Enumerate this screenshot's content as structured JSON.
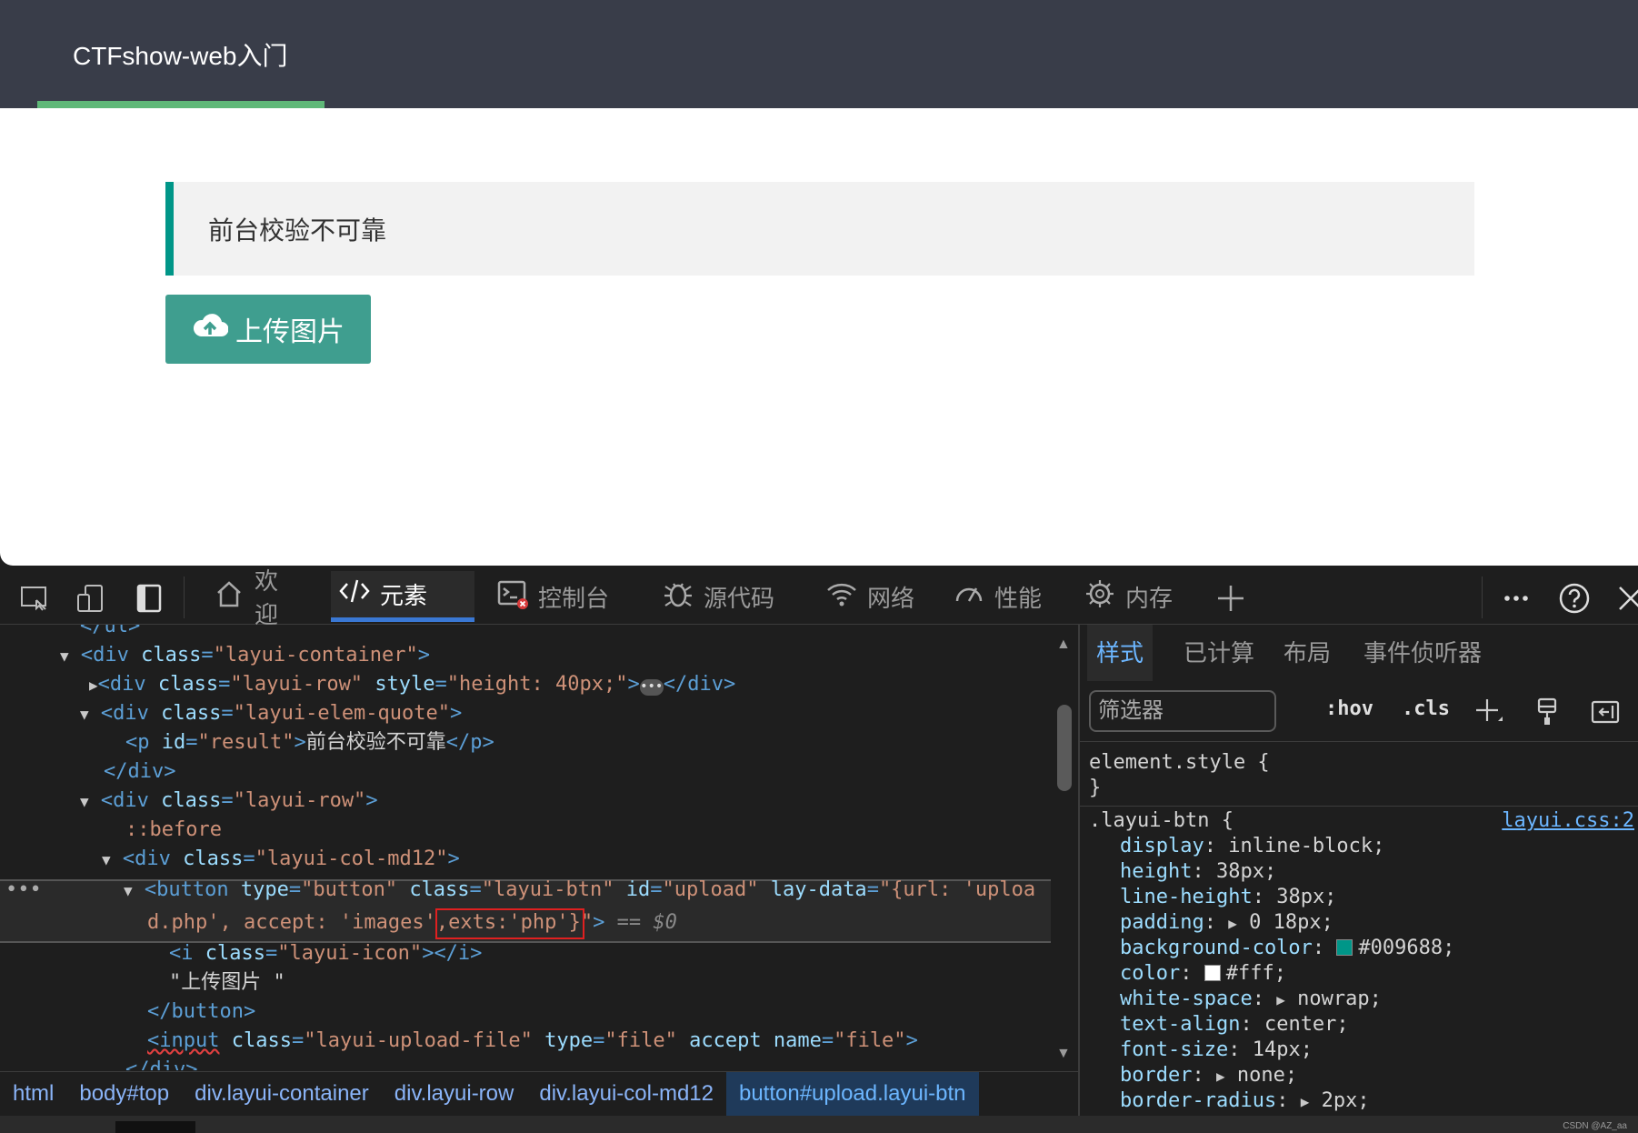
{
  "page": {
    "site_title": "CTFshow-web入门",
    "quote_text": "前台校验不可靠",
    "upload_button_label": "上传图片",
    "accent_color": "#009688"
  },
  "devtools": {
    "tabs": [
      {
        "label": "欢迎",
        "icon": "home-icon"
      },
      {
        "label": "元素",
        "icon": "code-icon",
        "active": true
      },
      {
        "label": "控制台",
        "icon": "console-icon"
      },
      {
        "label": "源代码",
        "icon": "bug-icon"
      },
      {
        "label": "网络",
        "icon": "wifi-icon"
      },
      {
        "label": "性能",
        "icon": "gauge-icon"
      },
      {
        "label": "内存",
        "icon": "chip-icon"
      }
    ],
    "dom": {
      "l0_tag": "</ul>",
      "l1_tag": "<div",
      "l1_attr": "class",
      "l1_val": "\"layui-container\"",
      "l2_tag": "<div",
      "l2_attr1": "class",
      "l2_val1": "\"layui-row\"",
      "l2_attr2": "style",
      "l2_val2": "\"height: 40px;\"",
      "l2_close": "</div>",
      "l3_tag": "<div",
      "l3_attr": "class",
      "l3_val": "\"layui-elem-quote\"",
      "l4_tag": "<p",
      "l4_attr": "id",
      "l4_val": "\"result\"",
      "l4_text": "前台校验不可靠",
      "l4_close": "</p>",
      "l5_tag": "</div>",
      "l6_tag": "<div",
      "l6_attr": "class",
      "l6_val": "\"layui-row\"",
      "l7_pseudo": "::before",
      "l8_tag": "<div",
      "l8_attr": "class",
      "l8_val": "\"layui-col-md12\"",
      "l9_tag": "<button",
      "l9_a1": "type",
      "l9_v1": "\"button\"",
      "l9_a2": "class",
      "l9_v2": "\"layui-btn\"",
      "l9_a3": "id",
      "l9_v3": "\"upload\"",
      "l9_a4": "lay-data",
      "l9_v4a": "\"{url: 'uploa",
      "l10_v4b": "d.php', accept: 'images'",
      "l10_v4c": ",exts:'php'}",
      "l10_v4d": "\"",
      "l10_eq": "== $0",
      "l11_tag": "<i",
      "l11_attr": "class",
      "l11_val": "\"layui-icon\"",
      "l11_text": "",
      "l11_close": "</i>",
      "l12_text": "\"上传图片 \"",
      "l13_tag": "</button>",
      "l14_tag": "<input",
      "l14_a1": "class",
      "l14_v1": "\"layui-upload-file\"",
      "l14_a2": "type",
      "l14_v2": "\"file\"",
      "l14_a3": "accept",
      "l14_a4": "name",
      "l14_v4": "\"file\"",
      "l15_tag": "</div>"
    },
    "breadcrumb": [
      "html",
      "body#top",
      "div.layui-container",
      "div.layui-row",
      "div.layui-col-md12",
      "button#upload.layui-btn"
    ],
    "styles": {
      "tabs": [
        "样式",
        "已计算",
        "布局",
        "事件侦听器"
      ],
      "filter_placeholder": "筛选器",
      "hov_label": ":hov",
      "cls_label": ".cls",
      "element_style_open": "element.style {",
      "element_style_close": "}",
      "rule_selector": ".layui-btn {",
      "rule_source": "layui.css:2",
      "declarations": [
        {
          "prop": "display",
          "val": "inline-block;"
        },
        {
          "prop": "height",
          "val": "38px;"
        },
        {
          "prop": "line-height",
          "val": "38px;"
        },
        {
          "prop": "padding",
          "val": "0 18px;",
          "expand": true
        },
        {
          "prop": "background-color",
          "val": "#009688;",
          "swatch": "#009688"
        },
        {
          "prop": "color",
          "val": "#fff;",
          "swatch": "#ffffff"
        },
        {
          "prop": "white-space",
          "val": "nowrap;",
          "expand": true
        },
        {
          "prop": "text-align",
          "val": "center;"
        },
        {
          "prop": "font-size",
          "val": "14px;"
        },
        {
          "prop": "border",
          "val": "none;",
          "expand": true
        },
        {
          "prop": "border-radius",
          "val": "2px;",
          "expand": true
        }
      ]
    },
    "watermark": "CSDN @AZ_aa"
  }
}
